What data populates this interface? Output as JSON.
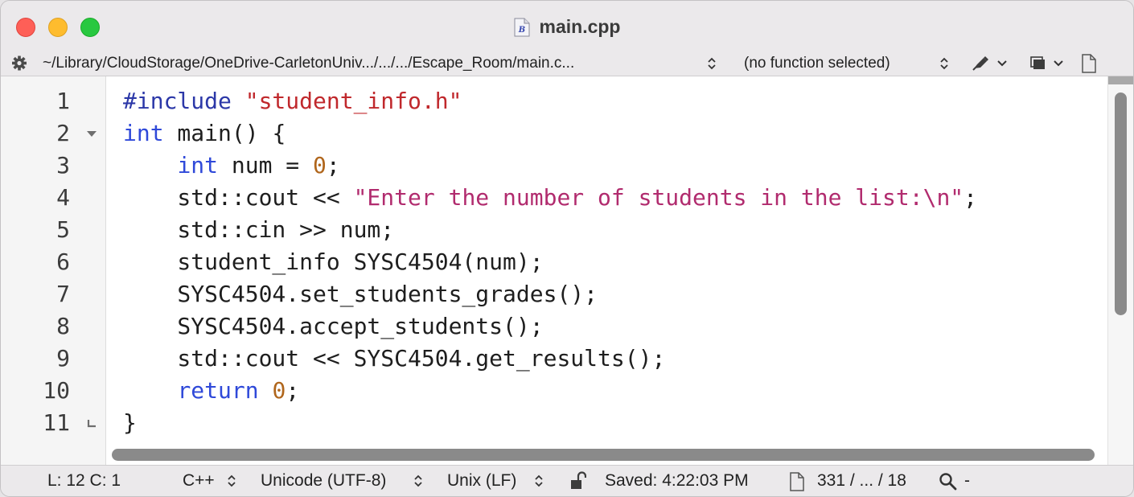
{
  "window": {
    "title": "main.cpp"
  },
  "navbar": {
    "path": "~/Library/CloudStorage/OneDrive-CarletonUniv.../.../.../Escape_Room/main.c...",
    "function_menu": "(no function selected)"
  },
  "editor": {
    "line_numbers": [
      "1",
      "2",
      "3",
      "4",
      "5",
      "6",
      "7",
      "8",
      "9",
      "10",
      "11"
    ],
    "lines": [
      [
        {
          "t": "#include ",
          "c": "pp"
        },
        {
          "t": "\"student_info.h\"",
          "c": "st1"
        }
      ],
      [
        {
          "t": "int",
          "c": "kw"
        },
        {
          "t": " main() {",
          "c": ""
        }
      ],
      [
        {
          "t": "    ",
          "c": ""
        },
        {
          "t": "int",
          "c": "kw"
        },
        {
          "t": " num = ",
          "c": ""
        },
        {
          "t": "0",
          "c": "nm"
        },
        {
          "t": ";",
          "c": ""
        }
      ],
      [
        {
          "t": "    std::cout << ",
          "c": ""
        },
        {
          "t": "\"Enter the number of students in the list:\\n\"",
          "c": "st2"
        },
        {
          "t": ";",
          "c": ""
        }
      ],
      [
        {
          "t": "    std::cin >> num;",
          "c": ""
        }
      ],
      [
        {
          "t": "    student_info SYSC4504(num);",
          "c": ""
        }
      ],
      [
        {
          "t": "    SYSC4504.set_students_grades();",
          "c": ""
        }
      ],
      [
        {
          "t": "    SYSC4504.accept_students();",
          "c": ""
        }
      ],
      [
        {
          "t": "    std::cout << SYSC4504.get_results();",
          "c": ""
        }
      ],
      [
        {
          "t": "    ",
          "c": ""
        },
        {
          "t": "return",
          "c": "kw"
        },
        {
          "t": " ",
          "c": ""
        },
        {
          "t": "0",
          "c": "nm"
        },
        {
          "t": ";",
          "c": ""
        }
      ],
      [
        {
          "t": "}",
          "c": ""
        }
      ]
    ]
  },
  "statusbar": {
    "cursor": "L: 12 C: 1",
    "language": "C++",
    "encoding": "Unicode (UTF-8)",
    "line_endings": "Unix (LF)",
    "saved": "Saved: 4:22:03 PM",
    "counts": "331 / ... / 18",
    "search_suffix": "-"
  },
  "icons": {
    "gear": "gear-icon",
    "pen": "pen-icon",
    "document": "document-icon",
    "lock": "lock-icon",
    "search": "search-icon"
  },
  "colors": {
    "keyword": "#2f49d9",
    "preprocessor": "#2c38a8",
    "include_string": "#c0282c",
    "string": "#b12b6e",
    "number": "#b0661c"
  }
}
